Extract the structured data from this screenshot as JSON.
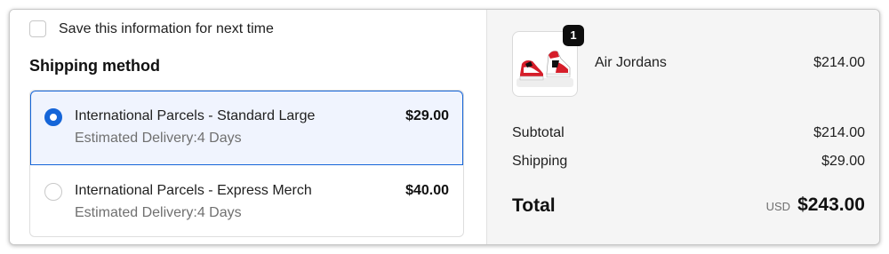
{
  "contact": {
    "save_label": "Save this information for next time",
    "save_checked": false
  },
  "shipping": {
    "title": "Shipping method",
    "options": [
      {
        "name": "International Parcels - Standard Large",
        "delivery": "Estimated Delivery:4 Days",
        "price": "$29.00",
        "selected": true
      },
      {
        "name": "International Parcels - Express Merch",
        "delivery": "Estimated Delivery:4 Days",
        "price": "$40.00",
        "selected": false
      }
    ]
  },
  "summary": {
    "item": {
      "name": "Air Jordans",
      "price": "$214.00",
      "quantity": "1",
      "image_icon": "sneakers-image"
    },
    "subtotal_label": "Subtotal",
    "subtotal_value": "$214.00",
    "shipping_label": "Shipping",
    "shipping_value": "$29.00",
    "total_label": "Total",
    "currency": "USD",
    "total_value": "$243.00"
  },
  "colors": {
    "accent": "#1565d8",
    "selected_bg": "#f0f4fe",
    "summary_bg": "#f5f5f5"
  }
}
